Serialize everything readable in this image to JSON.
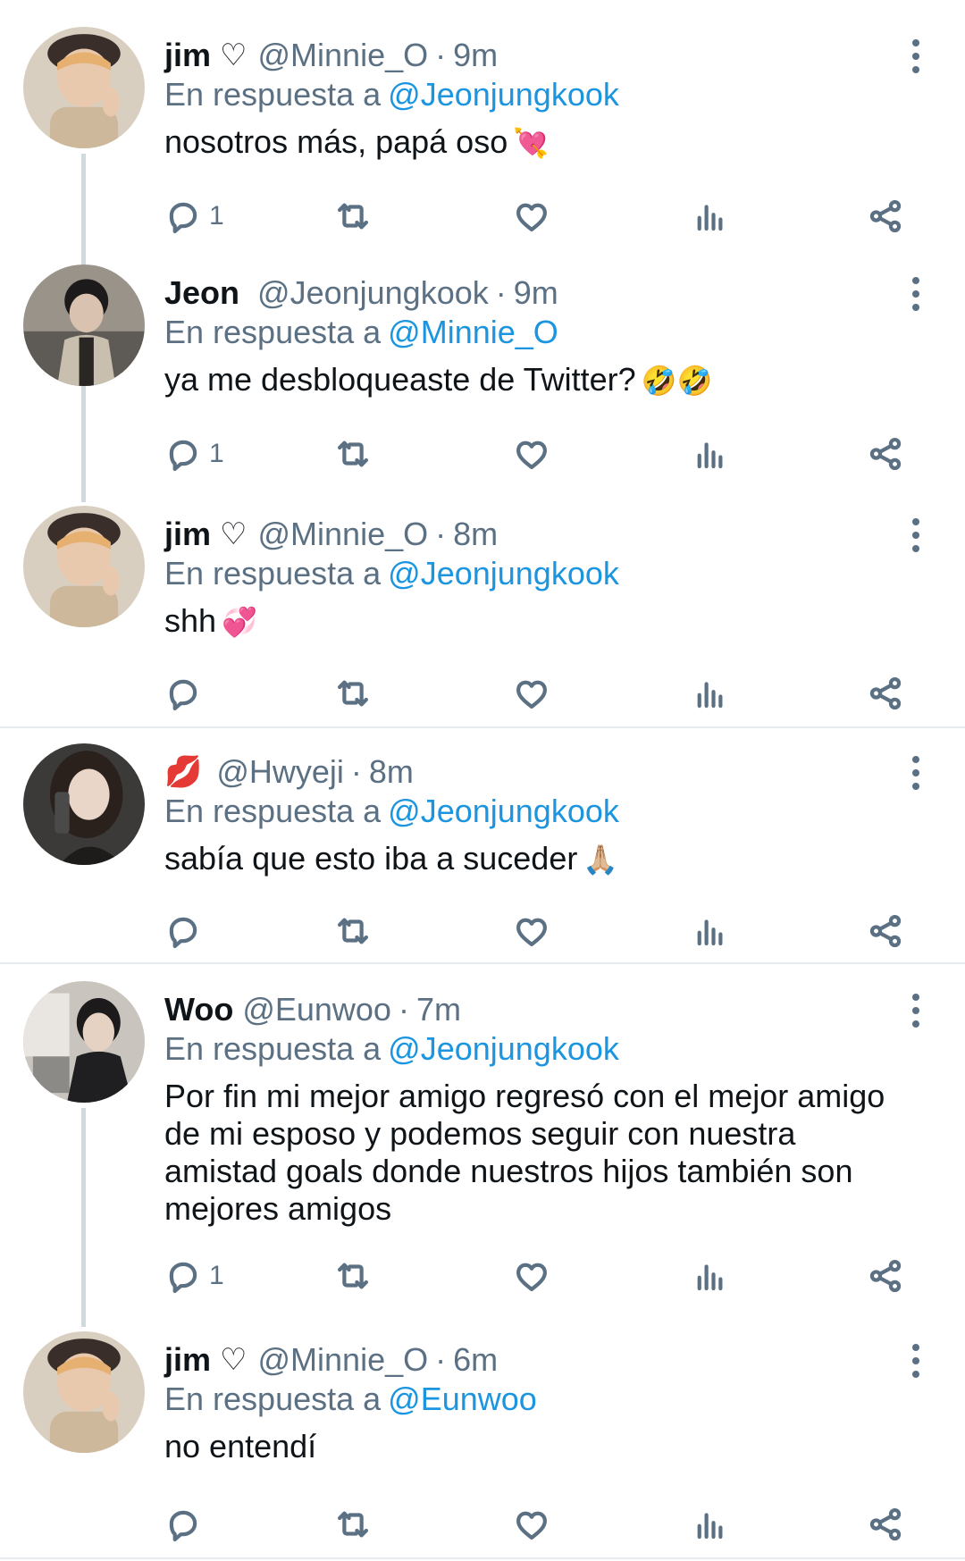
{
  "ui": {
    "reply_prefix": "En respuesta a",
    "dot": "·"
  },
  "colors": {
    "text": "#0f1419",
    "secondary": "#5b7083",
    "link": "#1b95e0",
    "divider": "#e6ecf0",
    "thread_line": "#cfd9de"
  },
  "tweets": [
    {
      "name": "jim",
      "name_suffix_icon": "heart-outline-icon",
      "name_suffix": "♡",
      "handle": "@Minnie_O",
      "time": "9m",
      "reply_to": "@Jeonjungkook",
      "text": "nosotros más, papá oso",
      "emoji": "💘",
      "reply_count": "1"
    },
    {
      "name": "Jeon",
      "handle": "@Jeonjungkook",
      "time": "9m",
      "reply_to": "@Minnie_O",
      "text": "ya me desbloqueaste de Twitter?",
      "emoji": "🤣🤣",
      "reply_count": "1"
    },
    {
      "name": "jim",
      "name_suffix_icon": "heart-outline-icon",
      "name_suffix": "♡",
      "handle": "@Minnie_O",
      "time": "8m",
      "reply_to": "@Jeonjungkook",
      "text": "shh",
      "emoji": "💞",
      "reply_count": ""
    },
    {
      "name": "",
      "name_icon": "kiss-mark-icon",
      "name_emoji": "💋",
      "handle": "@Hwyeji",
      "time": "8m",
      "reply_to": "@Jeonjungkook",
      "text": "sabía que esto iba a suceder",
      "emoji": "🙏🏼",
      "reply_count": ""
    },
    {
      "name": "Woo",
      "handle": "@Eunwoo",
      "time": "7m",
      "reply_to": "@Jeonjungkook",
      "text": "Por fin mi mejor amigo regresó con el mejor amigo de mi esposo y podemos seguir con nuestra amistad goals donde nuestros hijos también son mejores amigos",
      "emoji": "",
      "reply_count": "1"
    },
    {
      "name": "jim",
      "name_suffix_icon": "heart-outline-icon",
      "name_suffix": "♡",
      "handle": "@Minnie_O",
      "time": "6m",
      "reply_to": "@Eunwoo",
      "text": "no entendí",
      "emoji": "",
      "reply_count": ""
    }
  ]
}
